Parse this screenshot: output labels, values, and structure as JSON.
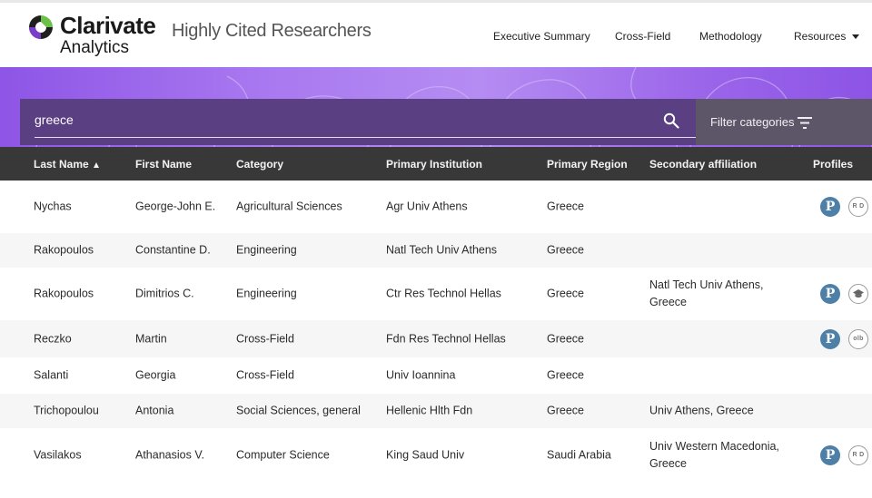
{
  "header": {
    "logo_name": "Clarivate",
    "logo_sub": "Analytics",
    "site_title": "Highly Cited Researchers",
    "nav": [
      {
        "label": "Executive Summary"
      },
      {
        "label": "Cross-Field"
      },
      {
        "label": "Methodology"
      },
      {
        "label": "Resources"
      }
    ]
  },
  "search": {
    "value": "greece",
    "placeholder": "",
    "icon": "search-icon",
    "filter_label": "Filter categories",
    "filter_icon": "filter-lines-icon"
  },
  "table": {
    "sorted_column": "Last Name",
    "sort_direction": "ascending",
    "columns": [
      {
        "label": "Last Name"
      },
      {
        "label": "First Name"
      },
      {
        "label": "Category"
      },
      {
        "label": "Primary Institution"
      },
      {
        "label": "Primary Region"
      },
      {
        "label": "Secondary affiliation"
      },
      {
        "label": "Profiles"
      }
    ],
    "rows": [
      {
        "last": "Nychas",
        "first": "George-John E.",
        "category": "Agricultural Sciences",
        "institution": "Agr Univ Athens",
        "region": "Greece",
        "secondary": "",
        "profiles": [
          {
            "icon": "publons-icon",
            "text": "P"
          },
          {
            "icon": "researcherid-icon",
            "text": "R D"
          }
        ]
      },
      {
        "last": "Rakopoulos",
        "first": "Constantine D.",
        "category": "Engineering",
        "institution": "Natl Tech Univ Athens",
        "region": "Greece",
        "secondary": "",
        "profiles": []
      },
      {
        "last": "Rakopoulos",
        "first": "Dimitrios C.",
        "category": "Engineering",
        "institution": "Ctr Res Technol Hellas",
        "region": "Greece",
        "secondary": "Natl Tech Univ Athens, Greece",
        "profiles": [
          {
            "icon": "publons-icon",
            "text": "P"
          },
          {
            "icon": "google-scholar-icon",
            "text": ""
          }
        ]
      },
      {
        "last": "Reczko",
        "first": "Martin",
        "category": "Cross-Field",
        "institution": "Fdn Res Technol Hellas",
        "region": "Greece",
        "secondary": "",
        "profiles": [
          {
            "icon": "publons-icon",
            "text": "P"
          },
          {
            "icon": "orcid-icon",
            "text": "olb"
          }
        ]
      },
      {
        "last": "Salanti",
        "first": "Georgia",
        "category": "Cross-Field",
        "institution": "Univ Ioannina",
        "region": "Greece",
        "secondary": "",
        "profiles": []
      },
      {
        "last": "Trichopoulou",
        "first": "Antonia",
        "category": "Social Sciences, general",
        "institution": "Hellenic Hlth Fdn",
        "region": "Greece",
        "secondary": "Univ Athens, Greece",
        "profiles": []
      },
      {
        "last": "Vasilakos",
        "first": "Athanasios V.",
        "category": "Computer Science",
        "institution": "King Saud Univ",
        "region": "Saudi Arabia",
        "secondary": "Univ Western Macedonia, Greece",
        "profiles": [
          {
            "icon": "publons-icon",
            "text": "P"
          },
          {
            "icon": "researcherid-icon",
            "text": "R D"
          }
        ]
      }
    ]
  },
  "colors": {
    "header_bg": "#383838",
    "search_bg": "#5a3f82",
    "filter_bg": "#5d5668",
    "hero_purple": "#9c66ea",
    "publons_blue": "#4e7fa6",
    "logo_green": "#6cc04a"
  }
}
